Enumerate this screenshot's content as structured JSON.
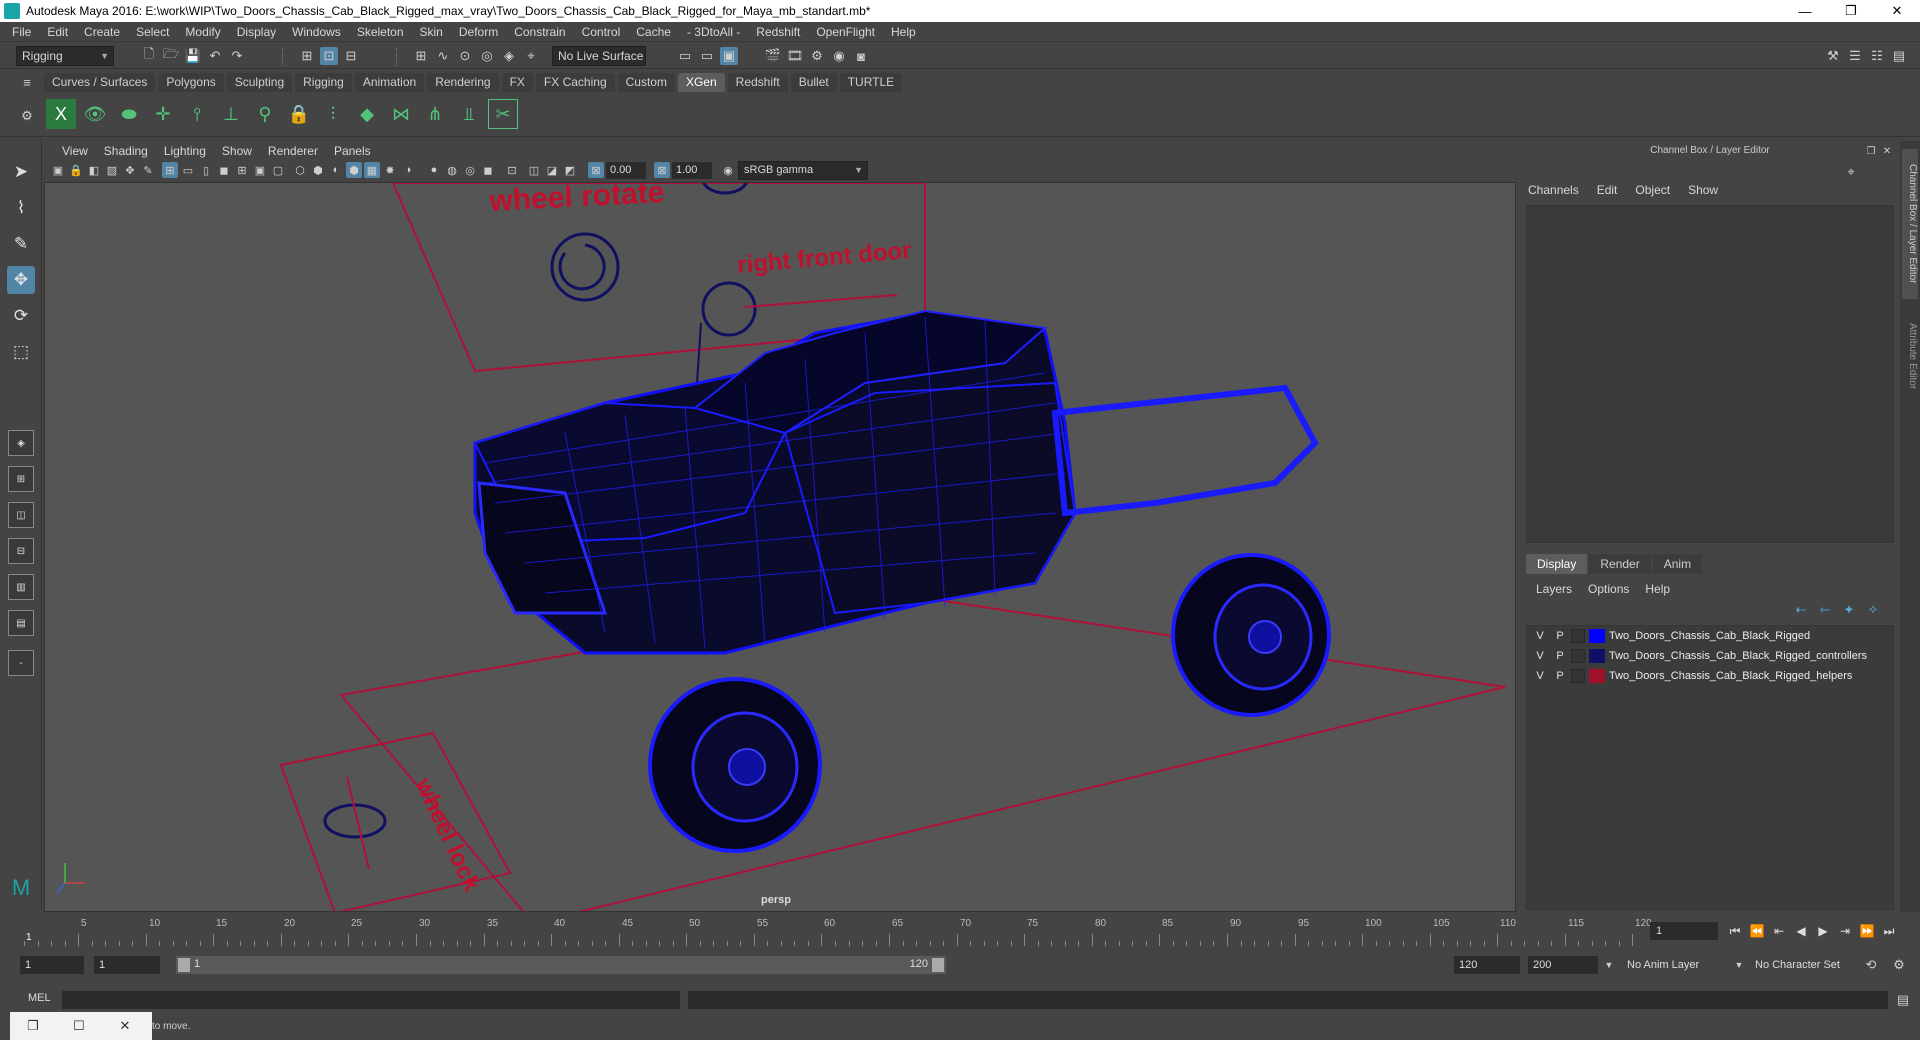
{
  "window": {
    "title": "Autodesk Maya 2016: E:\\work\\WIP\\Two_Doors_Chassis_Cab_Black_Rigged_max_vray\\Two_Doors_Chassis_Cab_Black_Rigged_for_Maya_mb_standart.mb*",
    "minimize": "—",
    "restore": "❐",
    "close": "✕"
  },
  "menu": [
    "File",
    "Edit",
    "Create",
    "Select",
    "Modify",
    "Display",
    "Windows",
    "Skeleton",
    "Skin",
    "Deform",
    "Constrain",
    "Control",
    "Cache",
    "- 3DtoAll -",
    "Redshift",
    "OpenFlight",
    "Help"
  ],
  "status": {
    "menuset": "Rigging",
    "live_surface": "No Live Surface"
  },
  "shelf_tabs": [
    "Curves / Surfaces",
    "Polygons",
    "Sculpting",
    "Rigging",
    "Animation",
    "Rendering",
    "FX",
    "FX Caching",
    "Custom",
    "XGen",
    "Redshift",
    "Bullet",
    "TURTLE"
  ],
  "shelf_active": "XGen",
  "viewport": {
    "menu": [
      "View",
      "Shading",
      "Lighting",
      "Show",
      "Renderer",
      "Panels"
    ],
    "exposure": "0.00",
    "gamma": "1.00",
    "color_space": "sRGB gamma",
    "camera": "persp",
    "labels": {
      "wheel_rotate": "wheel rotate",
      "right_front_door": "right front door",
      "wheel_lock": "wheel lock"
    }
  },
  "channel_box": {
    "title": "Channel Box / Layer Editor",
    "menu": [
      "Channels",
      "Edit",
      "Object",
      "Show"
    ],
    "layer_tabs": [
      "Display",
      "Render",
      "Anim"
    ],
    "layer_tab_active": "Display",
    "layer_menu": [
      "Layers",
      "Options",
      "Help"
    ],
    "layers": [
      {
        "v": "V",
        "p": "P",
        "color": "#0000ff",
        "name": "Two_Doors_Chassis_Cab_Black_Rigged"
      },
      {
        "v": "V",
        "p": "P",
        "color": "#10106a",
        "name": "Two_Doors_Chassis_Cab_Black_Rigged_controllers"
      },
      {
        "v": "V",
        "p": "P",
        "color": "#a0102a",
        "name": "Two_Doors_Chassis_Cab_Black_Rigged_helpers"
      }
    ]
  },
  "side_tabs": [
    "Channel Box / Layer Editor",
    "Attribute Editor"
  ],
  "timeline": {
    "labels": [
      "5",
      "10",
      "15",
      "20",
      "25",
      "30",
      "35",
      "40",
      "45",
      "50",
      "55",
      "60",
      "65",
      "70",
      "75",
      "80",
      "85",
      "90",
      "95",
      "100",
      "105",
      "110",
      "115",
      "120"
    ],
    "start_marker": "1",
    "current_frame": "1"
  },
  "range": {
    "start": "1",
    "playback_start": "1",
    "bar_start": "1",
    "bar_end": "120",
    "playback_end": "120",
    "end": "200",
    "anim_layer": "No Anim Layer",
    "char_set": "No Character Set"
  },
  "cmd": {
    "label": "MEL"
  },
  "help": {
    "text": "to move."
  }
}
